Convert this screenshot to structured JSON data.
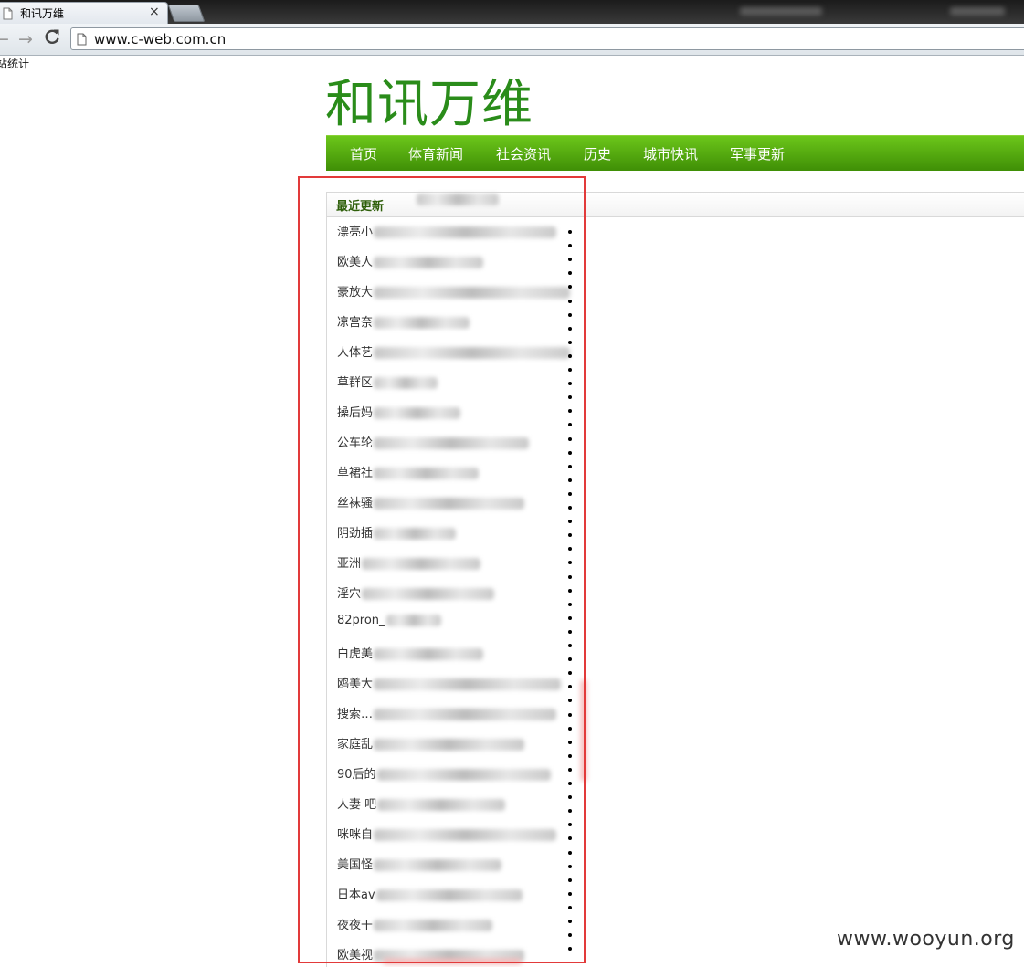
{
  "browser": {
    "tab_title": "和讯万维",
    "close_glyph": "×",
    "url": "www.c-web.com.cn"
  },
  "page": {
    "stat_text": "站统计",
    "logo": "和讯万维",
    "nav": [
      "首页",
      "体育新闻",
      "社会资讯",
      "历史",
      "城市快讯",
      "军事更新"
    ],
    "panel_title": "最近更新",
    "items": [
      "漂亮小",
      "欧美人",
      "豪放大",
      "凉宫奈",
      "人体艺",
      "草群区",
      "操后妈",
      "公车轮",
      "草裙社",
      "丝袜骚",
      "阴劲插",
      "亚洲",
      "淫穴",
      "82pron_",
      "白虎美",
      "鸥美大",
      "搜索…",
      "家庭乱",
      "90后的",
      "人妻 吧",
      "咪咪自",
      "美国怪",
      "日本av",
      "夜夜干",
      "欧美视"
    ]
  },
  "watermark": "www.wooyun.org",
  "colors": {
    "nav_green": "#4ea70c",
    "logo_green": "#2a8c1a",
    "highlight_red": "#e23a3a"
  }
}
